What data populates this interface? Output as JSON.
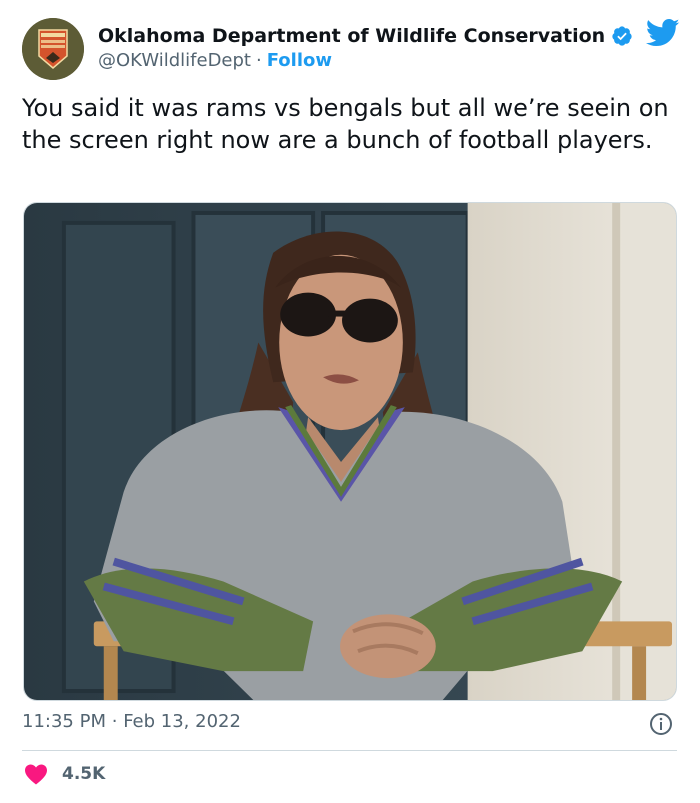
{
  "author": {
    "display_name": "Oklahoma Department of Wildlife Conservation",
    "handle": "@OKWildlifeDept",
    "separator": "·",
    "follow_label": "Follow",
    "avatar_icon": "odwc-badge-logo",
    "verified_icon": "verified-badge-icon",
    "brand_color": "#1d9bf0"
  },
  "tweet": {
    "text": "You said it was rams vs bengals but all we’re seein on the screen right now are a bunch of football players.",
    "media_description_icon": "photo"
  },
  "meta": {
    "time": "11:35 PM",
    "separator": "·",
    "date": "Feb 13, 2022"
  },
  "engagement": {
    "likes": "4.5K",
    "heart_color": "#f91880"
  }
}
